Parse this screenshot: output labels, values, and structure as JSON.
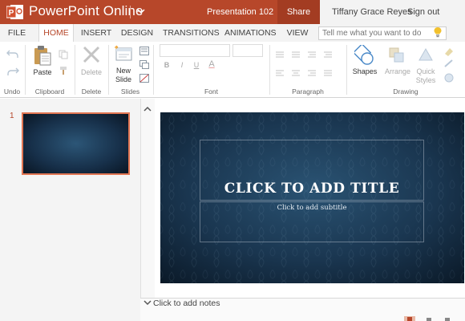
{
  "app": {
    "name": "PowerPoint Online",
    "logo_letter": "P",
    "document_title": "Presentation 102",
    "share_label": "Share",
    "user_name": "Tiffany Grace Reyes",
    "sign_out_label": "Sign out",
    "brand_color": "#b7472a"
  },
  "tabs": [
    {
      "label": "FILE"
    },
    {
      "label": "HOME",
      "active": true
    },
    {
      "label": "INSERT"
    },
    {
      "label": "DESIGN"
    },
    {
      "label": "TRANSITIONS"
    },
    {
      "label": "ANIMATIONS"
    },
    {
      "label": "VIEW"
    }
  ],
  "tell_me": {
    "placeholder": "Tell me what you want to do",
    "icon": "lightbulb-icon"
  },
  "ribbon": {
    "groups": {
      "undo": "Undo",
      "clipboard": "Clipboard",
      "delete": "Delete",
      "slides": "Slides",
      "font": "Font",
      "paragraph": "Paragraph",
      "drawing": "Drawing"
    },
    "buttons": {
      "paste": "Paste",
      "delete": "Delete",
      "new_slide_line1": "New",
      "new_slide_line2": "Slide",
      "shapes": "Shapes",
      "arrange": "Arrange",
      "quick_styles_line1": "Quick",
      "quick_styles_line2": "Styles"
    },
    "font_glyphs": {
      "bold": "B",
      "italic": "I",
      "underline": "U",
      "font_color": "A"
    }
  },
  "thumbnail_panel": {
    "slide_number": "1"
  },
  "slide": {
    "title_placeholder": "CLICK TO ADD TITLE",
    "subtitle_placeholder": "Click to add subtitle",
    "background_color": "#1c3447"
  },
  "notes": {
    "placeholder": "Click to add notes"
  }
}
